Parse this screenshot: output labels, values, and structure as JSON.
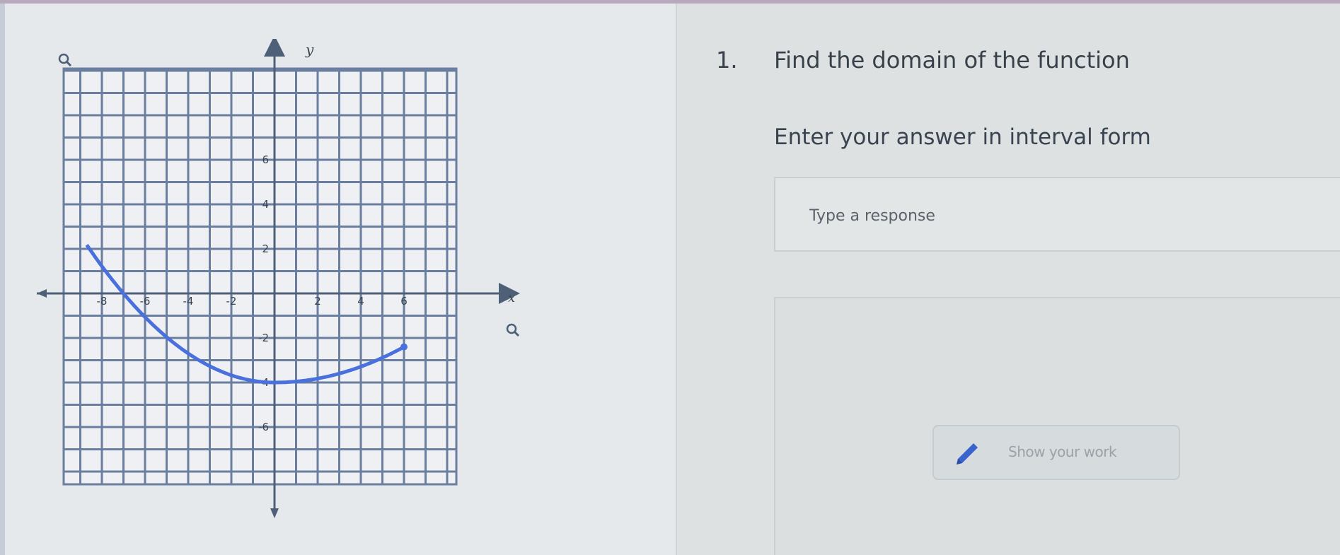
{
  "question": {
    "number": "1.",
    "text": "Find the domain of the function",
    "instruction": "Enter your answer in interval form"
  },
  "response": {
    "placeholder": "Type a response",
    "value": ""
  },
  "show_work": {
    "label": "Show your work",
    "icon": "pencil-icon"
  },
  "graph": {
    "axis_labels": {
      "x": "x",
      "y": "y"
    },
    "x_ticks": [
      "-8",
      "-6",
      "-4",
      "-2",
      "2",
      "4",
      "6"
    ],
    "y_ticks": [
      "6",
      "4",
      "2",
      "-2",
      "-4",
      "-6"
    ],
    "curve_color": "#4a70de",
    "grid_color": "#6a7fa0",
    "zoom_icons": [
      "magnifier-icon",
      "magnifier-icon"
    ]
  }
}
